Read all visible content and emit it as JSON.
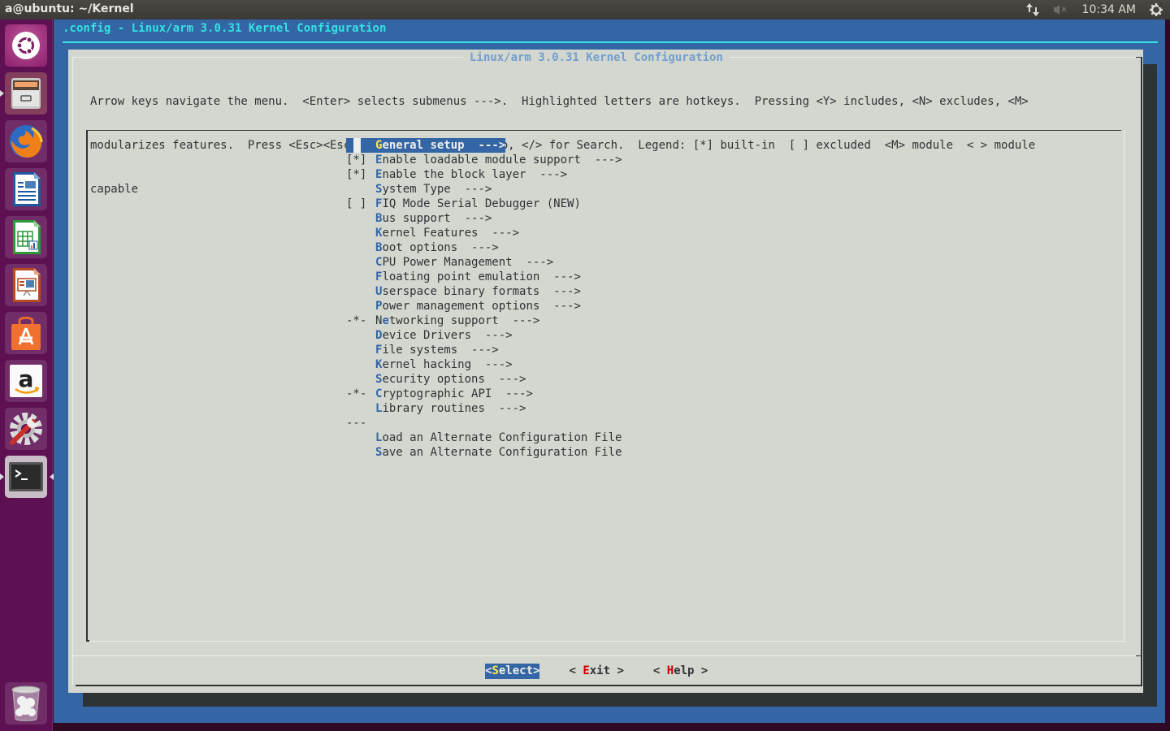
{
  "top_panel": {
    "window_title": "a@ubuntu: ~/Kernel",
    "tray": {
      "network_icon": "network-updown-icon",
      "volume_icon": "volume-muted-icon",
      "clock": "10:34 AM",
      "session_icon": "gear-power-icon"
    }
  },
  "launcher": {
    "items": [
      {
        "name": "dash-home",
        "icon": "ubuntu-logo-icon"
      },
      {
        "name": "files",
        "icon": "file-cabinet-icon",
        "running": true
      },
      {
        "name": "firefox",
        "icon": "firefox-icon"
      },
      {
        "name": "libreoffice-writer",
        "icon": "writer-document-icon"
      },
      {
        "name": "libreoffice-calc",
        "icon": "calc-spreadsheet-icon"
      },
      {
        "name": "libreoffice-impress",
        "icon": "impress-presentation-icon"
      },
      {
        "name": "ubuntu-software-center",
        "icon": "shopping-bag-icon"
      },
      {
        "name": "amazon",
        "icon": "amazon-icon"
      },
      {
        "name": "system-settings",
        "icon": "settings-wrench-icon"
      },
      {
        "name": "terminal",
        "icon": "terminal-icon",
        "running": true,
        "focused": true
      },
      {
        "name": "trash",
        "icon": "trash-icon"
      }
    ]
  },
  "terminal": {
    "backtitle": ".config - Linux/arm 3.0.31 Kernel Configuration",
    "dialog": {
      "title": "Linux/arm 3.0.31 Kernel Configuration",
      "help_lines": [
        "Arrow keys navigate the menu.  <Enter> selects submenus --->.  Highlighted letters are hotkeys.  Pressing <Y> includes, <N> excludes, <M>",
        "modularizes features.  Press <Esc><Esc> to exit, <?> for Help, </> for Search.  Legend: [*] built-in  [ ] excluded  <M> module  < > module",
        "capable"
      ],
      "menu_items": [
        {
          "prefix": "",
          "pre": "",
          "hot": "G",
          "rest": "eneral setup  --->",
          "selected": true
        },
        {
          "prefix": "[*]",
          "pre": "",
          "hot": "E",
          "rest": "nable loadable module support  --->"
        },
        {
          "prefix": "[*]",
          "pre": "",
          "hot": "E",
          "rest": "nable the block layer  --->"
        },
        {
          "prefix": "",
          "pre": "",
          "hot": "S",
          "rest": "ystem Type  --->"
        },
        {
          "prefix": "[ ]",
          "pre": "",
          "hot": "F",
          "rest": "IQ Mode Serial Debugger (NEW)"
        },
        {
          "prefix": "",
          "pre": "",
          "hot": "B",
          "rest": "us support  --->"
        },
        {
          "prefix": "",
          "pre": "",
          "hot": "K",
          "rest": "ernel Features  --->"
        },
        {
          "prefix": "",
          "pre": "",
          "hot": "B",
          "rest": "oot options  --->"
        },
        {
          "prefix": "",
          "pre": "",
          "hot": "C",
          "rest": "PU Power Management  --->"
        },
        {
          "prefix": "",
          "pre": "",
          "hot": "F",
          "rest": "loating point emulation  --->"
        },
        {
          "prefix": "",
          "pre": "",
          "hot": "U",
          "rest": "serspace binary formats  --->"
        },
        {
          "prefix": "",
          "pre": "",
          "hot": "P",
          "rest": "ower management options  --->"
        },
        {
          "prefix": "-*-",
          "pre": "N",
          "hot": "e",
          "rest": "tworking support  --->"
        },
        {
          "prefix": "",
          "pre": "",
          "hot": "D",
          "rest": "evice Drivers  --->"
        },
        {
          "prefix": "",
          "pre": "",
          "hot": "F",
          "rest": "ile systems  --->"
        },
        {
          "prefix": "",
          "pre": "",
          "hot": "K",
          "rest": "ernel hacking  --->"
        },
        {
          "prefix": "",
          "pre": "",
          "hot": "S",
          "rest": "ecurity options  --->"
        },
        {
          "prefix": "-*-",
          "pre": "",
          "hot": "C",
          "rest": "ryptographic API  --->"
        },
        {
          "prefix": "",
          "pre": "",
          "hot": "L",
          "rest": "ibrary routines  --->"
        },
        {
          "prefix": "---",
          "pre": "",
          "hot": "",
          "rest": ""
        },
        {
          "prefix": "",
          "pre": "",
          "hot": "L",
          "rest": "oad an Alternate Configuration File"
        },
        {
          "prefix": "",
          "pre": "",
          "hot": "S",
          "rest": "ave an Alternate Configuration File"
        }
      ],
      "buttons": [
        {
          "pre": "<",
          "hot": "S",
          "rest": "elect>",
          "active": true
        },
        {
          "pre": "< ",
          "hot": "E",
          "rest": "xit >",
          "active": false
        },
        {
          "pre": "< ",
          "hot": "H",
          "rest": "elp >",
          "active": false
        }
      ]
    }
  },
  "colors": {
    "terminal_bg": "#3465a4",
    "dialog_bg": "#d3d7cf",
    "hotkey": "#3465a4",
    "selected_hotkey": "#fce94f",
    "button_hotkey": "#cc0000",
    "backtitle": "#34e2e2",
    "launcher_bg": "#5e1152"
  }
}
